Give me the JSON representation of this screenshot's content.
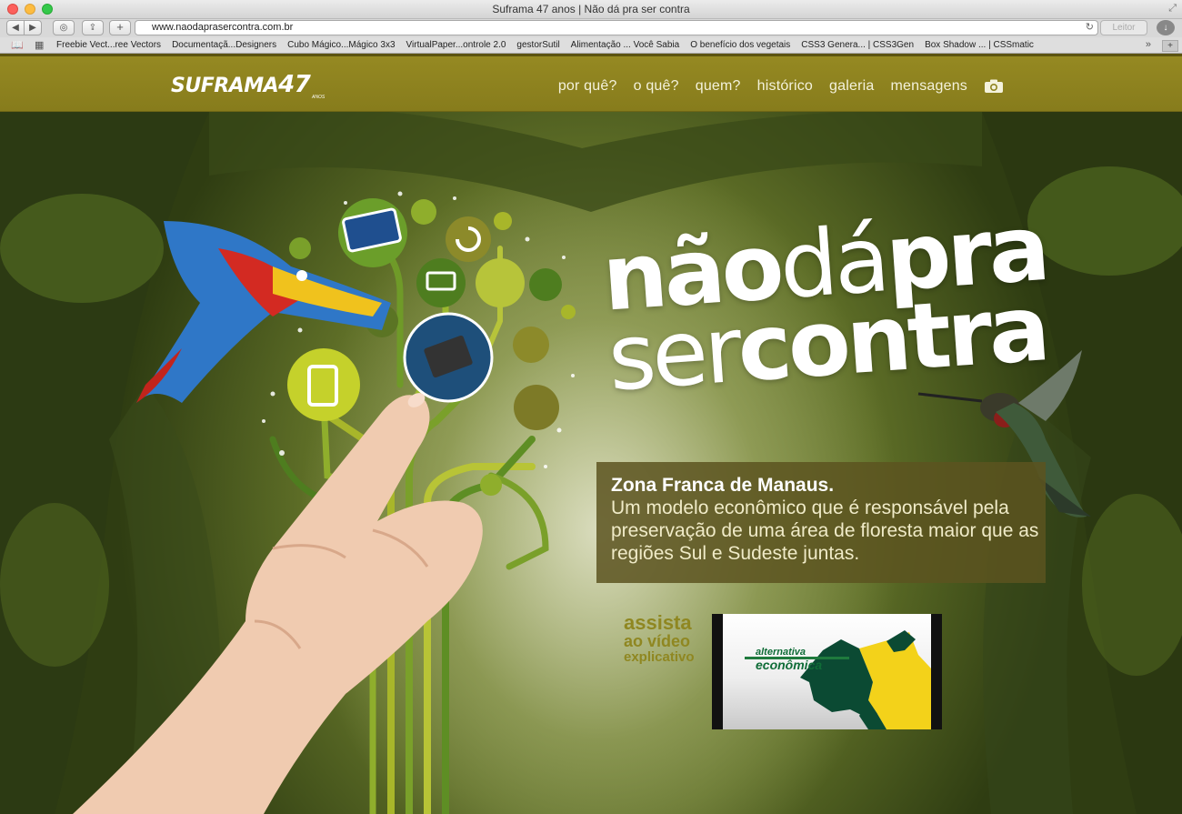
{
  "browser": {
    "window_title": "Suframa 47 anos | Não dá pra ser contra",
    "url": "www.naodaprasercontra.com.br",
    "reader_label": "Leitor",
    "bookmarks": [
      "Freebie Vect...ree Vectors",
      "Documentaçã...Designers",
      "Cubo Mágico...Mágico 3x3",
      "VirtualPaper...ontrole 2.0",
      "gestorSutil",
      "Alimentação ... Você Sabia",
      "O benefício dos vegetais",
      "CSS3 Genera... | CSS3Gen",
      "Box Shadow ... | CSSmatic"
    ],
    "icons": [
      "back-icon",
      "forward-icon",
      "reader-icon",
      "share-icon",
      "plus-icon",
      "reload-icon",
      "download-icon",
      "bookmarks-icon",
      "grid-icon",
      "chevron-more-icon"
    ]
  },
  "header": {
    "logo_text": "SUFRAMA",
    "logo_number": "47",
    "logo_sub": "ANOS",
    "nav": [
      {
        "label": "por quê?"
      },
      {
        "label": "o quê?"
      },
      {
        "label": "quem?"
      },
      {
        "label": "histórico"
      },
      {
        "label": "galeria"
      },
      {
        "label": "mensagens"
      }
    ],
    "camera_icon": "camera-icon",
    "colors": {
      "bar": "#8f8420",
      "text": "#f4f2dc"
    }
  },
  "hero": {
    "headline": {
      "line1_bold": "não",
      "line1_light": "dá",
      "line1_bold2": "pra",
      "line2_light": "ser",
      "line2_bold": "contra"
    },
    "info_title": "Zona Franca de Manaus.",
    "info_text": "Um modelo econômico que é responsável pela preservação de uma área de floresta maior que as regiões Sul e Sudeste juntas.",
    "video_cta": {
      "line1": "assista",
      "line2": "ao vídeo",
      "line3": "explicativo"
    },
    "video_thumb": {
      "line1": "alternativa",
      "line2": "econômica"
    },
    "colors": {
      "accent": "#8f8721",
      "box": "#5c5420",
      "tree_green": "#a8b62a",
      "dark_green": "#4e7d1f"
    }
  }
}
